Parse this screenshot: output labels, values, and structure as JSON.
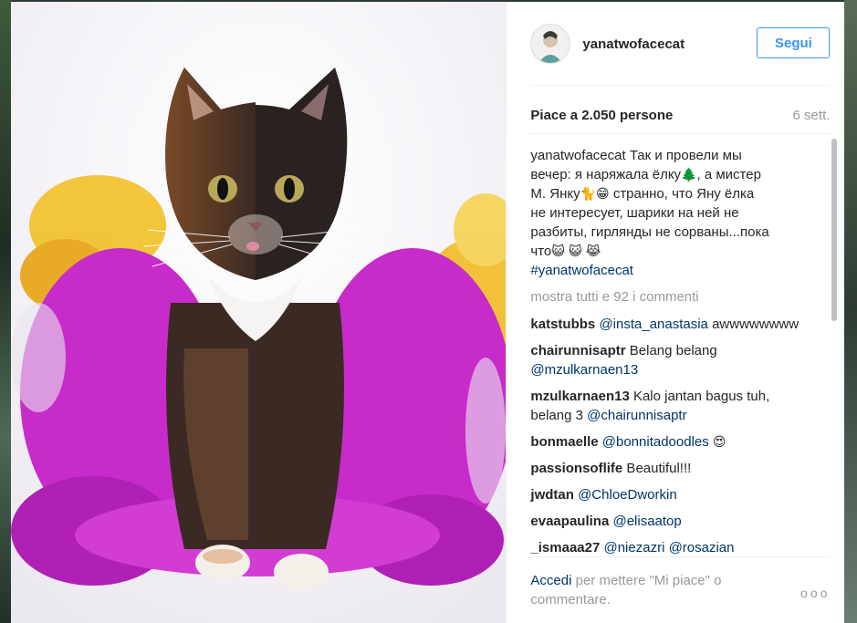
{
  "post": {
    "username": "yanatwofacecat",
    "follow_label": "Segui",
    "likes_text": "Piace a 2.050 persone",
    "date": "6 sett."
  },
  "caption": {
    "username": "yanatwofacecat",
    "lines": [
      "Так и провели мы",
      "вечер: я наряжала ёлку",
      ", а мистер",
      "М. Янку",
      "странно, что Яну ёлка",
      "не интересует, шарики на ней не",
      "разбиты, гирлянды не сорваны...пока",
      "что",
      "#yanatwofacecat"
    ],
    "emojis": [
      "🌲",
      "🐈",
      "😁",
      "😺",
      "😺",
      "😹"
    ]
  },
  "more_comments_label": "mostra tutti e 92 i commenti",
  "comments": [
    {
      "user": "katstubbs",
      "mention": "@insta_anastasia",
      "text": " awwwwwwww",
      "emoji": ""
    },
    {
      "user": "chairunnisaptr",
      "mention": "",
      "text": " Belang belang",
      "line2": "@mzulkarnaen13",
      "emoji": ""
    },
    {
      "user": "mzulkarnaen13",
      "mention": "",
      "text": " Kalo jantan bagus tuh,",
      "line2_text": "belang 3 ",
      "line2_mention": "@chairunnisaptr",
      "emoji": ""
    },
    {
      "user": "bonmaelle",
      "mention": "@bonnitadoodles",
      "text": "",
      "emoji": "😍"
    },
    {
      "user": "passionsoflife",
      "mention": "",
      "text": " Beautiful!!!",
      "emoji": ""
    },
    {
      "user": "jwdtan",
      "mention": "@ChloeDworkin",
      "text": "",
      "emoji": ""
    },
    {
      "user": "evaapaulina",
      "mention": "@elisaatop",
      "text": "",
      "emoji": ""
    },
    {
      "user": "_ismaaa27",
      "mention": "@niezazri @rosazian",
      "text": "",
      "emoji": ""
    }
  ],
  "footer": {
    "login_label": "Accedi",
    "rest_text": " per mettere \"Mi piace\" o commentare.",
    "more_label": "ooo"
  },
  "colors": {
    "accent_blue": "#3897f0",
    "link": "#003569",
    "muted": "#999999",
    "tinsel_magenta": "#c829c8",
    "tinsel_gold": "#f0b020"
  }
}
